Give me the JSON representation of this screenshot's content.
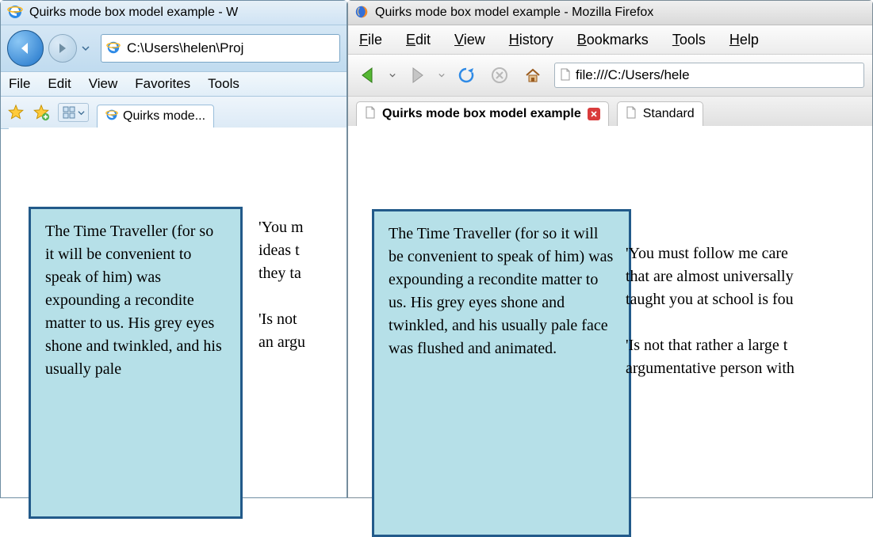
{
  "ie": {
    "title": "Quirks mode box model example - W",
    "address": "C:\\Users\\helen\\Proj",
    "menu": [
      "File",
      "Edit",
      "View",
      "Favorites",
      "Tools"
    ],
    "tab_label": "Quirks mode...",
    "content": {
      "blue": "The Time Traveller (for so it will be convenient to speak of him) was expounding a recondite matter to us. His grey eyes shone and twinkled, and his usually pale",
      "right": "'You m\nideas t\nthey ta\n\n'Is not\nan argu"
    }
  },
  "ff": {
    "title": "Quirks mode box model example - Mozilla Firefox",
    "menu": [
      "File",
      "Edit",
      "View",
      "History",
      "Bookmarks",
      "Tools",
      "Help"
    ],
    "address": "file:///C:/Users/hele",
    "tabs": [
      {
        "label": "Quirks mode box model example",
        "active": true,
        "closable": true
      },
      {
        "label": "Standard",
        "active": false,
        "closable": false
      }
    ],
    "content": {
      "blue": "The Time Traveller (for so it will be convenient to speak of him) was expounding a recondite matter to us. His grey eyes shone and twinkled, and his usually pale face was flushed and animated.",
      "right": "'You must follow me care\nthat are almost universally\ntaught you at school is fou\n\n'Is not that rather a large t\nargumentative person with"
    }
  },
  "colors": {
    "box_border": "#225a8a",
    "box_fill": "#b6e0e8"
  }
}
